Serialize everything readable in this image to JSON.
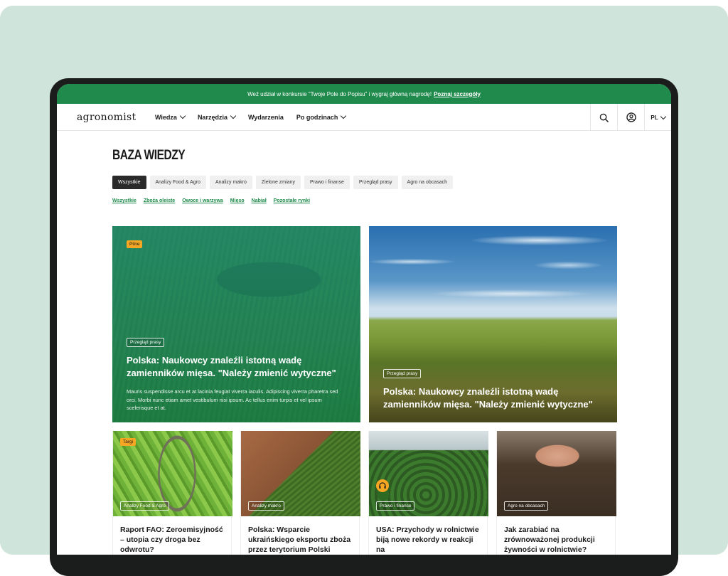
{
  "promo": {
    "text": "Weź udział w konkursie \"Twoje Pole do Popisu\" i wygraj główną nagrodę!",
    "link": "Poznaj szczegóły"
  },
  "header": {
    "logo": "agronomist",
    "nav": [
      "Wiedza",
      "Narzędzia",
      "Wydarzenia",
      "Po godzinach"
    ],
    "lang": "PL",
    "icons": [
      "search-icon",
      "user-icon",
      "chevron-down-icon"
    ]
  },
  "page": {
    "title": "BAZA WIEDZY",
    "tabs": [
      "Wszystkie",
      "Analizy Food & Agro",
      "Analizy makro",
      "Zielone zmiany",
      "Prawo i finanse",
      "Przegląd prasy",
      "Agro na obcasach"
    ],
    "active_tab": "Wszystkie",
    "subtabs": [
      "Wszystkie",
      "Zboża oleiste",
      "Owoce i warzywa",
      "Mięso",
      "Nabiał",
      "Pozostałe rynki"
    ]
  },
  "featured": [
    {
      "top_badge": "Pilne",
      "category": "Przegląd prasy",
      "title": "Polska: Naukowcy znaleźli istotną wadę zamienników mięsa. \"Należy zmienić wytyczne\"",
      "description": "Mauris suspendisse arcu et at lacinia feugiat viverra iaculis. Adipiscing viverra pharetra sed orci. Morbi nunc etiam amet vestibulum nisi ipsum. Ac tellus enim turpis et vel ipsum scelerisque et at."
    },
    {
      "category": "Przegląd prasy",
      "title": "Polska: Naukowcy znaleźli istotną wadę zamienników mięsa. \"Należy zmienić wytyczne\""
    }
  ],
  "cards": [
    {
      "top_badge": "Targi",
      "category": "Analizy Food & Agro",
      "title": "Raport FAO: Zeroemisyjność – utopia czy droga bez odwrotu?"
    },
    {
      "category": "Analizy makro",
      "title": "Polska: Wsparcie ukraińskiego eksportu zboża przez terytorium Polski"
    },
    {
      "category": "Prawo i finanse",
      "title": "USA: Przychody w rolnictwie biją nowe rekordy w reakcji na",
      "icon": "headphones-icon"
    },
    {
      "category": "Agro na obcasach",
      "title": "Jak zarabiać na zrównoważonej produkcji żywności w rolnictwie?"
    }
  ],
  "colors": {
    "brand_green": "#1f8a4c",
    "accent_orange": "#f5a623",
    "background": "#cfe4da"
  }
}
